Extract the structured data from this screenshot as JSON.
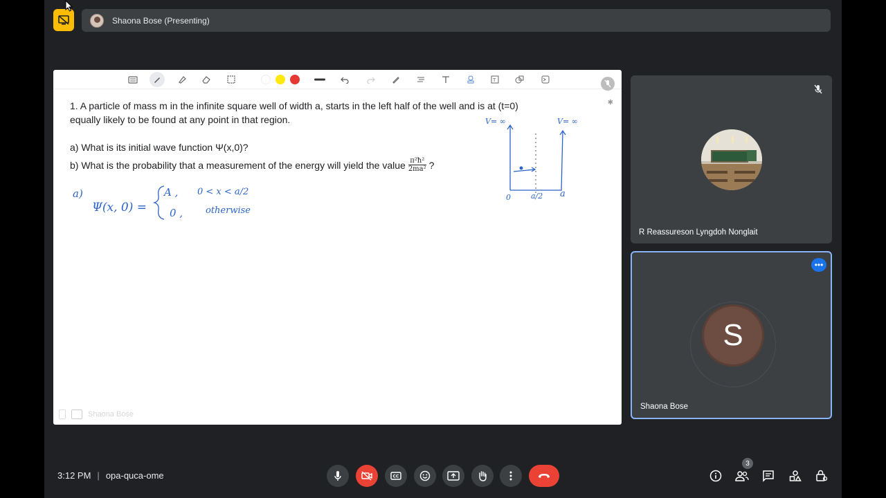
{
  "presenting": {
    "label": "Shaona Bose (Presenting)"
  },
  "whiteboard": {
    "question_1_line_1": "1. A particle of mass m in the infinite square well of width a, starts in the left half of the well and is at (t=0)",
    "question_1_line_2": "equally likely to be found at any point in that region.",
    "part_a": "a)  What is its initial wave function Ψ(x,0)?",
    "part_b": "b)  What is the probability that a measurement of the energy will yield the value",
    "energy_numerator": "π²ħ²",
    "energy_denominator": "2ma²",
    "part_b_end": "?",
    "hand_answer_label": "a)",
    "hand_psi": "Ψ(x, 0) =",
    "hand_case1_value": "A ,",
    "hand_case1_cond": "0 < x < a/2",
    "hand_case2_value": "0 ,",
    "hand_case2_cond": "otherwise",
    "sketch_left_label": "V= ∞",
    "sketch_right_label": "V= ∞",
    "sketch_x0": "0",
    "sketch_xmid": "a/2",
    "sketch_xa": "a",
    "footer_name": "Shaona Bose",
    "colors": {
      "yellow": "#fde910",
      "red": "#e53935",
      "ink": "#2b64c8"
    }
  },
  "participants": [
    {
      "name": "R Reassureson Lyngdoh Nonglait",
      "muted": true,
      "avatar": "classroom-photo"
    },
    {
      "name": "Shaona Bose",
      "initial": "S",
      "active_speaker": true
    }
  ],
  "bottom_bar": {
    "time": "3:12 PM",
    "separator": "|",
    "meeting_code": "opa-quca-ome",
    "people_count": "3",
    "controls": [
      "mic-icon",
      "camera-off-icon",
      "captions-icon",
      "emoji-icon",
      "present-icon",
      "raise-hand-icon",
      "more-vert-icon",
      "end-call-icon"
    ],
    "right_controls": [
      "info-icon",
      "people-icon",
      "chat-icon",
      "activities-icon",
      "host-controls-icon"
    ]
  }
}
